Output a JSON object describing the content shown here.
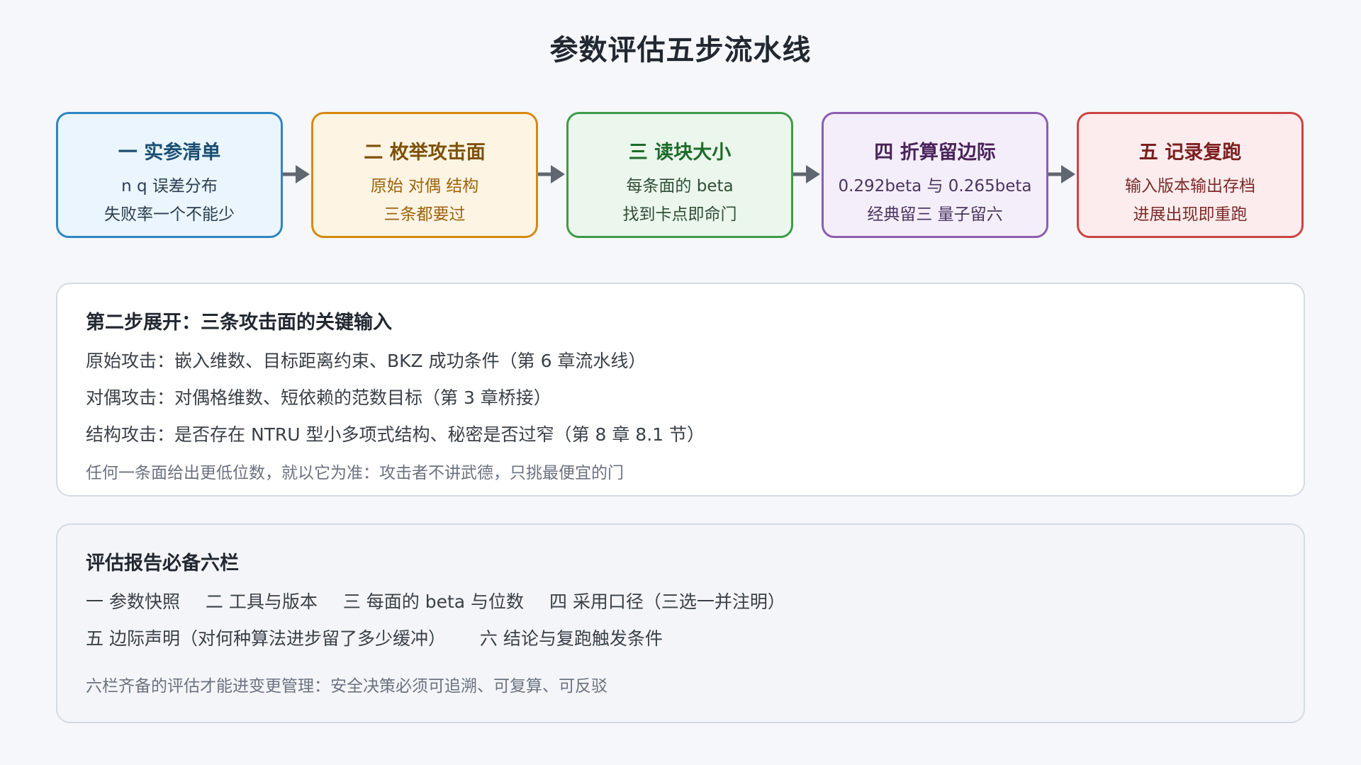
{
  "title": "参数评估五步流水线",
  "steps": [
    {
      "title": "一 实参清单",
      "line1": "n q 误差分布",
      "line2": "失败率一个不能少",
      "border": "#2e86c1",
      "bg": "#eaf5fd",
      "title_color": "#1b4f72",
      "text_color": "#2c3e50"
    },
    {
      "title": "二 枚举攻击面",
      "line1": "原始 对偶 结构",
      "line2": "三条都要过",
      "border": "#d68910",
      "bg": "#fdf4e3",
      "title_color": "#7e5109",
      "text_color": "#9c640c"
    },
    {
      "title": "三 读块大小",
      "line1": "每条面的 beta",
      "line2": "找到卡点即命门",
      "border": "#3d9b47",
      "bg": "#ebf6ec",
      "title_color": "#1e6b2a",
      "text_color": "#2f4f35"
    },
    {
      "title": "四 折算留边际",
      "line1": "0.292beta 与 0.265beta",
      "line2": "经典留三 量子留六",
      "border": "#8e5cb0",
      "bg": "#f4eefa",
      "title_color": "#4a235a",
      "text_color": "#4a3560"
    },
    {
      "title": "五 记录复跑",
      "line1": "输入版本输出存档",
      "line2": "进展出现即重跑",
      "border": "#cc4444",
      "bg": "#fdeced",
      "title_color": "#7b1f1f",
      "text_color": "#7b2b2b"
    }
  ],
  "panel1": {
    "heading": "第二步展开：三条攻击面的关键输入",
    "lines": [
      "原始攻击：嵌入维数、目标距离约束、BKZ 成功条件（第 6 章流水线）",
      "对偶攻击：对偶格维数、短依赖的范数目标（第 3 章桥接）",
      "结构攻击：是否存在 NTRU 型小多项式结构、秘密是否过窄（第 8 章 8.1 节）"
    ],
    "note": "任何一条面给出更低位数，就以它为准：攻击者不讲武德，只挑最便宜的门"
  },
  "panel2": {
    "heading": "评估报告必备六栏",
    "row1": [
      "一 参数快照",
      "二 工具与版本",
      "三 每面的 beta 与位数",
      "四 采用口径（三选一并注明）"
    ],
    "row2": [
      "五 边际声明（对何种算法进步留了多少缓冲）",
      "六 结论与复跑触发条件"
    ],
    "note": "六栏齐备的评估才能进变更管理：安全决策必须可追溯、可复算、可反驳"
  },
  "colors": {
    "arrow": "#5f6670"
  }
}
